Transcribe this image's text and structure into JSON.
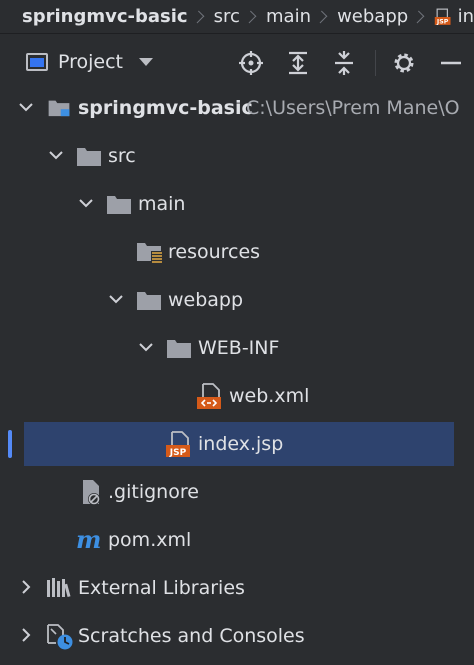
{
  "breadcrumb": [
    "springmvc-basic",
    "src",
    "main",
    "webapp",
    "in"
  ],
  "toolbar": {
    "title": "Project",
    "buttons": [
      "locate-icon",
      "expand-all-icon",
      "collapse-all-icon",
      "gear-icon",
      "minimize-icon"
    ]
  },
  "tree": {
    "root": {
      "label": "springmvc-basic",
      "path": "C:\\Users\\Prem Mane\\O"
    },
    "src": "src",
    "main": "main",
    "resources": "resources",
    "webapp": "webapp",
    "webinf": "WEB-INF",
    "webxml": "web.xml",
    "indexjsp": "index.jsp",
    "gitignore": ".gitignore",
    "pomxml": "pom.xml",
    "external_libraries": "External Libraries",
    "scratches": "Scratches and Consoles"
  },
  "colors": {
    "background": "#2b2d30",
    "selection": "#2e436e",
    "accent": "#548af7",
    "jsp_orange": "#d55a19",
    "maven_blue": "#3d8fe2"
  }
}
